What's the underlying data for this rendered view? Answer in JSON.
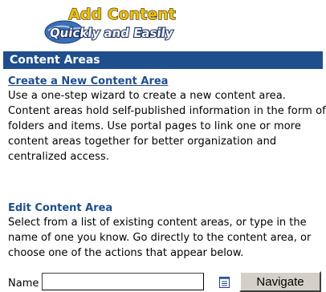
{
  "logo": {
    "line1": "Add Content",
    "line2": "Quickly and Easily"
  },
  "section": {
    "title": "Content Areas"
  },
  "create": {
    "link_label": "Create a New Content Area",
    "description": "Use a one-step wizard to create a new content area. Content areas hold self-published information in the form of folders and items. Use portal pages to link one or more content areas together for better organization and centralized access."
  },
  "edit": {
    "title": "Edit Content Area",
    "description": "Select from a list of existing content areas, or type in the name of one you know. Go directly to the content area, or choose one of the actions that appear below.",
    "name_label": "Name",
    "name_value": "",
    "navigate_label": "Navigate"
  },
  "colors": {
    "section_bar": "#1f4e8c",
    "link": "#1f4e8c"
  },
  "icons": {
    "list_picker": "list-icon"
  }
}
